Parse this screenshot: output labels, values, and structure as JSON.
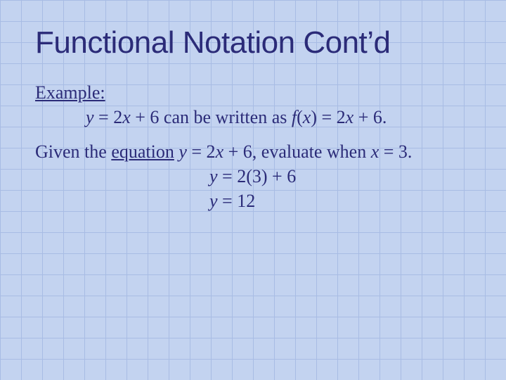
{
  "title": "Functional Notation Cont’d",
  "example_label": "Example:",
  "example_sentence": {
    "lhs_var": "y",
    "eq1": " = 2",
    "xvar1": "x",
    "mid": " + 6 can be written as ",
    "fn": "f",
    "open": "(",
    "xvar2": "x",
    "close_eq": ") = 2",
    "xvar3": "x",
    "tail": " + 6."
  },
  "given": {
    "pre": "Given the ",
    "u_word": "equation",
    "sp": " ",
    "yvar": "y",
    "eq": " = 2",
    "xvar": "x",
    "mid": " + 6, evaluate when ",
    "xvar2": "x",
    "tail": " = 3."
  },
  "work": {
    "l1_y": "y",
    "l1_rest": " = 2(3) + 6",
    "l2_y": "y",
    "l2_rest": " = 12"
  }
}
